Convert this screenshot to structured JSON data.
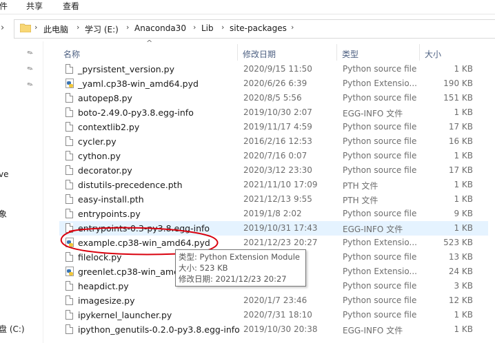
{
  "ribbon": {
    "tabs": [
      "件",
      "共享",
      "查看"
    ]
  },
  "address": {
    "crumbs": [
      "此电脑",
      "学习 (E:)",
      "Anaconda30",
      "Lib",
      "site-packages"
    ]
  },
  "nav_pane": {
    "texts": [
      "ve",
      "象",
      "盘 (C:)"
    ]
  },
  "columns": {
    "name": "名称",
    "date": "修改日期",
    "type": "类型",
    "size": "大小"
  },
  "files": [
    {
      "name": "_pyrsistent_version.py",
      "date": "2020/9/15 11:50",
      "type": "Python source file",
      "size": "1 KB",
      "icon": "file-icon"
    },
    {
      "name": "_yaml.cp38-win_amd64.pyd",
      "date": "2020/6/26 6:39",
      "type": "Python Extensio...",
      "size": "190 KB",
      "icon": "python-file-icon"
    },
    {
      "name": "autopep8.py",
      "date": "2020/8/5 5:56",
      "type": "Python source file",
      "size": "151 KB",
      "icon": "file-icon"
    },
    {
      "name": "boto-2.49.0-py3.8.egg-info",
      "date": "2019/10/30 2:07",
      "type": "EGG-INFO 文件",
      "size": "1 KB",
      "icon": "file-icon"
    },
    {
      "name": "contextlib2.py",
      "date": "2019/11/17 4:59",
      "type": "Python source file",
      "size": "17 KB",
      "icon": "file-icon"
    },
    {
      "name": "cycler.py",
      "date": "2016/2/16 12:53",
      "type": "Python source file",
      "size": "16 KB",
      "icon": "file-icon"
    },
    {
      "name": "cython.py",
      "date": "2020/7/16 0:07",
      "type": "Python source file",
      "size": "1 KB",
      "icon": "file-icon"
    },
    {
      "name": "decorator.py",
      "date": "2020/3/12 23:30",
      "type": "Python source file",
      "size": "17 KB",
      "icon": "file-icon"
    },
    {
      "name": "distutils-precedence.pth",
      "date": "2021/11/10 17:09",
      "type": "PTH 文件",
      "size": "1 KB",
      "icon": "file-icon"
    },
    {
      "name": "easy-install.pth",
      "date": "2021/12/13 9:55",
      "type": "PTH 文件",
      "size": "1 KB",
      "icon": "file-icon"
    },
    {
      "name": "entrypoints.py",
      "date": "2019/1/8 2:02",
      "type": "Python source file",
      "size": "9 KB",
      "icon": "file-icon"
    },
    {
      "name": "entrypoints-0.3-py3.8.egg-info",
      "date": "2019/10/31 17:43",
      "type": "EGG-INFO 文件",
      "size": "1 KB",
      "icon": "file-icon",
      "selected": true
    },
    {
      "name": "example.cp38-win_amd64.pyd",
      "date": "2021/12/23 20:27",
      "type": "Python Extensio...",
      "size": "523 KB",
      "icon": "python-file-icon"
    },
    {
      "name": "filelock.py",
      "date": "",
      "type": "Python source file",
      "size": "13 KB",
      "icon": "file-icon"
    },
    {
      "name": "greenlet.cp38-win_amd6",
      "date": "",
      "type": "Python Extensio...",
      "size": "24 KB",
      "icon": "python-file-icon"
    },
    {
      "name": "heapdict.py",
      "date": "",
      "type": "Python source file",
      "size": "3 KB",
      "icon": "file-icon"
    },
    {
      "name": "imagesize.py",
      "date": "2020/1/7 23:46",
      "type": "Python source file",
      "size": "12 KB",
      "icon": "file-icon"
    },
    {
      "name": "ipykernel_launcher.py",
      "date": "2020/7/31 18:10",
      "type": "Python source file",
      "size": "1 KB",
      "icon": "file-icon"
    },
    {
      "name": "ipython_genutils-0.2.0-py3.8.egg-info",
      "date": "2019/10/30 20:38",
      "type": "EGG-INFO 文件",
      "size": "1 KB",
      "icon": "file-icon"
    }
  ],
  "tooltip": {
    "type_line": "类型: Python Extension Module",
    "size_line": "大小: 523 KB",
    "date_line": "修改日期: 2021/12/23 20:27"
  },
  "colors": {
    "selection": "#e5f3ff",
    "annotation": "#d9000d"
  }
}
